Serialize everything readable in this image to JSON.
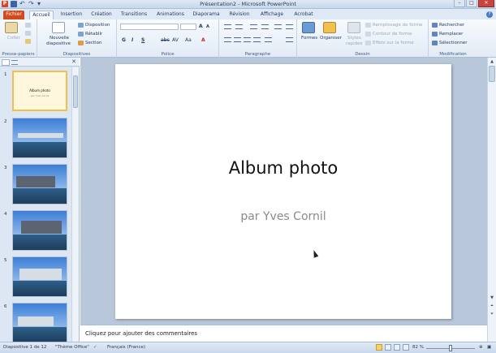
{
  "window": {
    "title": "Présentation2 - Microsoft PowerPoint",
    "app_icon_letter": "P",
    "controls": [
      "–",
      "□",
      "✕"
    ]
  },
  "tabs": [
    {
      "label": "Fichier"
    },
    {
      "label": "Accueil"
    },
    {
      "label": "Insertion"
    },
    {
      "label": "Création"
    },
    {
      "label": "Transitions"
    },
    {
      "label": "Animations"
    },
    {
      "label": "Diaporama"
    },
    {
      "label": "Révision"
    },
    {
      "label": "Affichage"
    },
    {
      "label": "Acrobat"
    }
  ],
  "help_label": "?",
  "ribbon": {
    "clipboard": {
      "label": "Presse-papiers",
      "paste": "Coller"
    },
    "slides": {
      "label": "Diapositives",
      "new_slide_line1": "Nouvelle",
      "new_slide_line2": "diapositive",
      "layout": "Disposition",
      "reset": "Rétablir",
      "section": "Section"
    },
    "font": {
      "label": "Police",
      "bold": "G",
      "italic": "I",
      "underline": "S",
      "strike": "abc",
      "spacing": "AV",
      "case": "Aa",
      "grow": "A",
      "shrink": "A"
    },
    "paragraph": {
      "label": "Paragraphe"
    },
    "drawing": {
      "label": "Dessin",
      "shapes": "Formes",
      "arrange": "Organiser",
      "quick_styles_line1": "Styles",
      "quick_styles_line2": "rapides",
      "fill": "Remplissage de forme",
      "outline": "Contour de forme",
      "effects": "Effets sur la forme"
    },
    "editing": {
      "label": "Modification",
      "find": "Rechercher",
      "replace": "Remplacer",
      "select": "Sélectionner"
    }
  },
  "thumbnails": [
    {
      "num": "1",
      "title": "Album photo",
      "subtitle": "par Yves Cornil"
    },
    {
      "num": "2"
    },
    {
      "num": "3"
    },
    {
      "num": "4"
    },
    {
      "num": "5"
    },
    {
      "num": "6"
    }
  ],
  "slide": {
    "title": "Album photo",
    "subtitle": "par Yves Cornil"
  },
  "notes_placeholder": "Cliquez pour ajouter des commentaires",
  "status": {
    "slide_info": "Diapositive 1 de 12",
    "theme": "\"Thème Office\"",
    "language": "Français (France)",
    "zoom": "82 %"
  }
}
